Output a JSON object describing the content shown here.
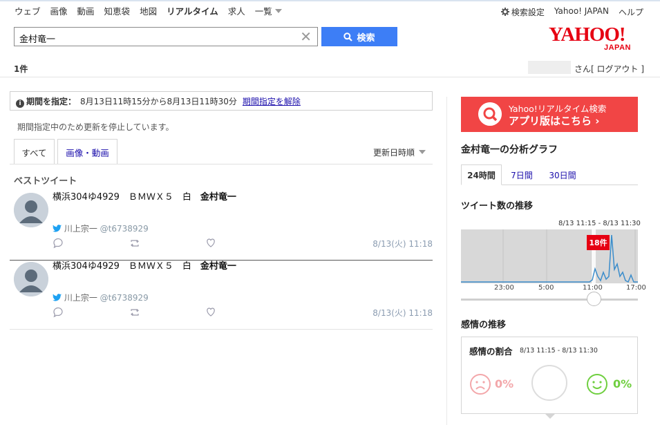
{
  "nav": {
    "items": [
      "ウェブ",
      "画像",
      "動画",
      "知恵袋",
      "地図",
      "リアルタイム",
      "求人",
      "一覧"
    ],
    "active": "リアルタイム"
  },
  "toplinks": {
    "settings": "検索設定",
    "yahoo_japan": "Yahoo! JAPAN",
    "help": "ヘルプ"
  },
  "search": {
    "value": "金村竜一",
    "button_label": "検索"
  },
  "logo": {
    "text": "YAHOO!",
    "sub": "JAPAN"
  },
  "result_count": "1件",
  "user": {
    "suffix": "さん",
    "logout": "[ ログアウト ]"
  },
  "period": {
    "label": "期間を指定：",
    "range": "8月13日11時15分から8月13日11時30分",
    "cancel": "期間指定を解除"
  },
  "stopped_notice": "期間指定中のため更新を停止しています。",
  "tabs": {
    "all": "すべて",
    "media": "画像・動画"
  },
  "sort_label": "更新日時順",
  "best_tweet_heading": "ベストツイート",
  "tweets": [
    {
      "text_prefix": "横浜304ゆ4929　ＢＭＷＸ５　白",
      "text_highlight": "金村竜一",
      "user_name": "川上宗一",
      "handle": "@t6738929",
      "time": "8/13(火) 11:18"
    },
    {
      "text_prefix": "横浜304ゆ4929　ＢＭＷＸ５　白",
      "text_highlight": "金村竜一",
      "user_name": "川上宗一",
      "handle": "@t6738929",
      "time": "8/13(火) 11:18"
    }
  ],
  "sidebar": {
    "banner_line1": "Yahoo!リアルタイム検索",
    "banner_line2": "アプリ版はこちら ›",
    "analysis_title": "金村竜一の分析グラフ",
    "range_tabs": [
      "24時間",
      "7日間",
      "30日間"
    ],
    "tweet_trend_title": "ツイート数の推移",
    "selected_range": "8/13 11:15 - 8/13 11:30",
    "selected_count": "18件",
    "axis_ticks": [
      "23:00",
      "5:00",
      "11:00",
      "17:00"
    ],
    "sentiment_trend_title": "感情の推移",
    "sentiment_box_title": "感情の割合",
    "sentiment_range": "8/13 11:15 - 8/13 11:30",
    "negative_pct": "0%",
    "positive_pct": "0%"
  },
  "colors": {
    "search_button": "#3d7ef6",
    "banner": "#f14545",
    "badge": "#e60012",
    "link": "#1a0dab",
    "chart_line": "#3a8ccb",
    "logo": "#e60012"
  }
}
